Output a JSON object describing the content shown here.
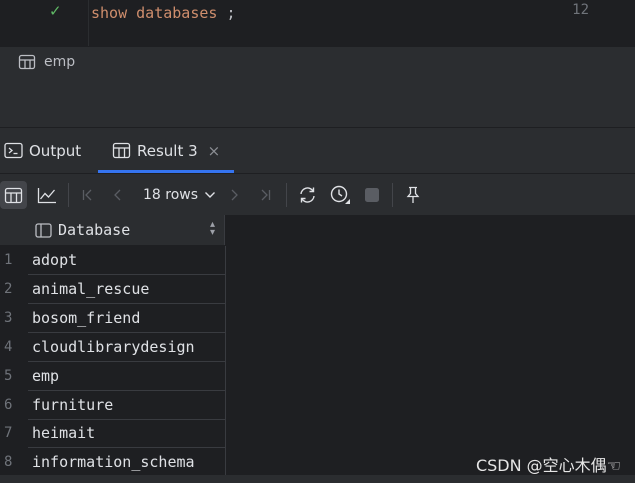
{
  "editor": {
    "line_number": "12",
    "status_icon": "check-icon",
    "code_keyword": "show databases",
    "code_terminator": " ;"
  },
  "breadcrumb": {
    "icon": "table-icon",
    "label": "emp"
  },
  "tool_tabs": [
    {
      "label": "Output",
      "icon": "console-icon",
      "active": false
    },
    {
      "label": "Result 3",
      "icon": "table-icon",
      "active": true,
      "close": "×"
    }
  ],
  "toolbar": {
    "rows_label": "18 rows",
    "buttons": [
      "table-view-icon",
      "chart-view-icon",
      "first-page-icon",
      "prev-page-icon",
      "next-page-icon",
      "last-page-icon",
      "reload-icon",
      "history-icon",
      "stop-icon",
      "pin-icon"
    ]
  },
  "grid": {
    "column": "Database",
    "rows": [
      {
        "num": "1",
        "value": "adopt"
      },
      {
        "num": "2",
        "value": "animal_rescue"
      },
      {
        "num": "3",
        "value": "bosom_friend"
      },
      {
        "num": "4",
        "value": "cloudlibrarydesign"
      },
      {
        "num": "5",
        "value": "emp"
      },
      {
        "num": "6",
        "value": "furniture"
      },
      {
        "num": "7",
        "value": "heimait"
      },
      {
        "num": "8",
        "value": "information_schema"
      }
    ]
  },
  "watermark": "CSDN @空心木偶☜",
  "colors": {
    "background": "#1e1f22",
    "panel": "#2b2d30",
    "keyword": "#cf8e6d",
    "accent": "#3574f0",
    "success": "#5fb865"
  }
}
